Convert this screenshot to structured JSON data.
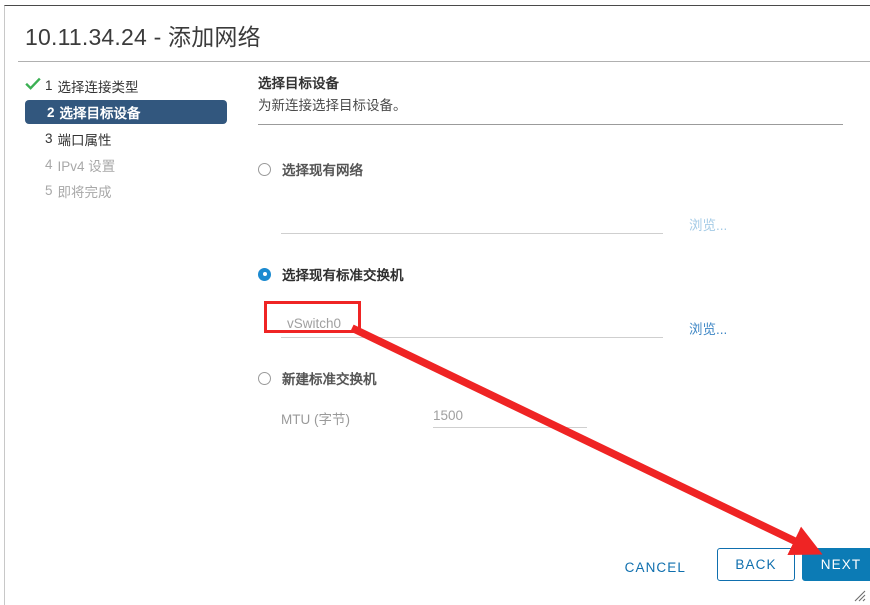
{
  "dialog": {
    "title": "10.11.34.24 - 添加网络"
  },
  "steps": [
    {
      "num": "1",
      "label": "选择连接类型",
      "state": "done"
    },
    {
      "num": "2",
      "label": "选择目标设备",
      "state": "active"
    },
    {
      "num": "3",
      "label": "端口属性",
      "state": "todo"
    },
    {
      "num": "4",
      "label": "IPv4 设置",
      "state": "disabled"
    },
    {
      "num": "5",
      "label": "即将完成",
      "state": "disabled"
    }
  ],
  "content": {
    "title": "选择目标设备",
    "subtitle": "为新连接选择目标设备。",
    "options": [
      {
        "label": "选择现有网络",
        "selected": false,
        "value": "",
        "browse_label": "浏览...",
        "browse_enabled": false
      },
      {
        "label": "选择现有标准交换机",
        "selected": true,
        "value": "vSwitch0",
        "browse_label": "浏览...",
        "browse_enabled": true
      },
      {
        "label": "新建标准交换机",
        "selected": false,
        "mtu_label": "MTU (字节)",
        "mtu_value": "1500"
      }
    ]
  },
  "footer": {
    "cancel_label": "CANCEL",
    "back_label": "BACK",
    "next_label": "NEXT"
  },
  "colors": {
    "accent_blue": "#0c7bb5",
    "link_blue": "#3f87c5",
    "active_step_bg": "#32577e",
    "check_green": "#3cb054",
    "annotation_red": "#ef2424"
  }
}
